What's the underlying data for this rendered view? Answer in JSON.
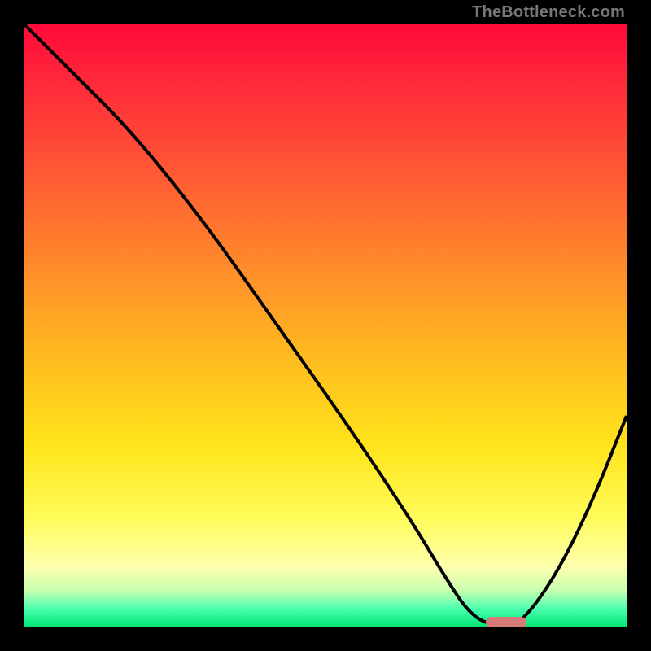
{
  "watermark": "TheBottleneck.com",
  "colors": {
    "gradient_top": "#ff0a3a",
    "gradient_mid": "#ffe41a",
    "gradient_bottom": "#00e676",
    "curve": "#000000",
    "frame": "#000000",
    "marker": "#d87a7a"
  },
  "chart_data": {
    "type": "line",
    "title": "",
    "xlabel": "",
    "ylabel": "",
    "xlim": [
      0,
      100
    ],
    "ylim": [
      0,
      100
    ],
    "grid": false,
    "legend": false,
    "series": [
      {
        "name": "bottleneck-curve",
        "x": [
          0,
          8,
          18,
          30,
          42,
          54,
          64,
          70,
          74,
          78,
          82,
          88,
          94,
          100
        ],
        "y": [
          100,
          92,
          82,
          67,
          50,
          33,
          18,
          8,
          2,
          0,
          0,
          8,
          20,
          35
        ]
      }
    ],
    "annotations": [
      {
        "name": "optimal-marker",
        "x": 80,
        "y": 0,
        "width": 6,
        "shape": "pill"
      }
    ],
    "notes": "Values are approximate, read from pixels on an unlabeled heat-gradient-vs-curve plot. y=0 is bottom (green), y=100 is top (red)."
  }
}
